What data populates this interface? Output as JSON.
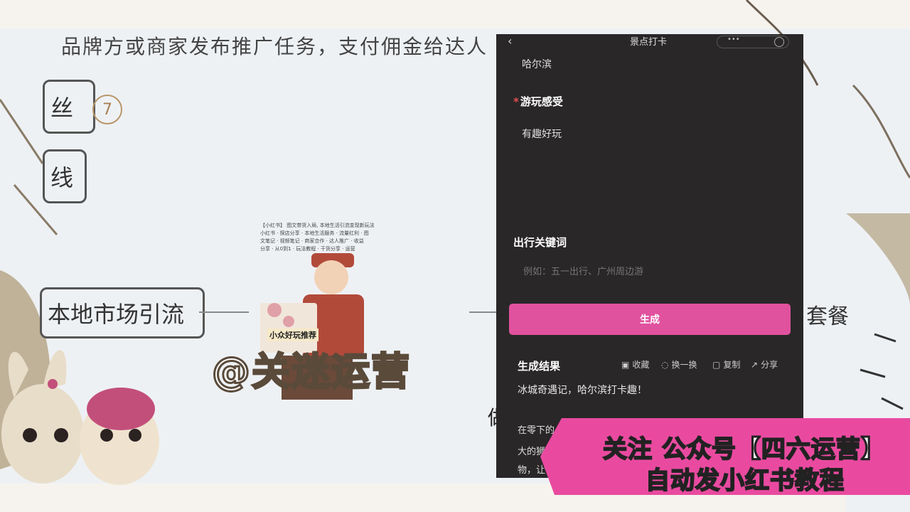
{
  "slide": {
    "top_line": "品牌方或商家发布推广任务，支付佣金给达人",
    "box1_text": "丝",
    "circle_number": "7",
    "box2_text": "线",
    "box3_text": "本地市场引流",
    "right_text": "套餐",
    "bottom_text": "做的"
  },
  "poster": {
    "lines": [
      "【小红书】 图文带货入局, 本地生活引流变现新玩法",
      "小红书 · 探店分享 · 本地生活服务 · 流量红利 · 图",
      "文笔记 · 视频笔记 · 商家合作 · 达人推广 · 收益",
      "分享 · 从0到1 · 玩法教程 · 干货分享 · 运营"
    ],
    "caption": "小众好玩推荐",
    "watermark": "@关迷运营"
  },
  "phone": {
    "title": "景点打卡",
    "back_icon": "chevron-left-icon",
    "city_value": "哈尔滨",
    "feeling_label": "游玩感受",
    "feeling_value": "有趣好玩",
    "keyword_label": "出行关键词",
    "keyword_placeholder": "例如：五一出行、广州周边游",
    "generate_button": "生成",
    "result_label": "生成结果",
    "actions": {
      "collect": "收藏",
      "refresh": "换一换",
      "copy": "复制",
      "share": "分享"
    },
    "result_text": "冰城奇遇记，哈尔滨打卡趣！",
    "result_more": [
      "在零下的",
      "大的狮",
      "物，让"
    ],
    "accent_color": "#e0519e"
  },
  "banner": {
    "line1": "关注 公众号【四六运营】",
    "line2": "自动发小红书教程",
    "color": "#e94aa0"
  }
}
